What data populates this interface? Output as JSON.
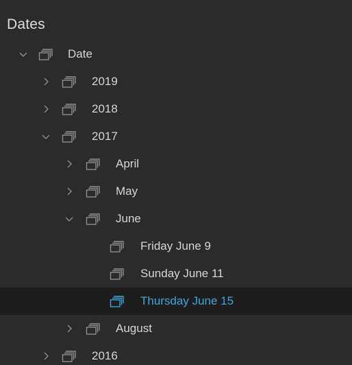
{
  "panel": {
    "title": "Dates"
  },
  "colors": {
    "background": "#2b2b2b",
    "selected_row": "#1d1d1d",
    "selected_text": "#3aa6dc",
    "text": "#d6d6d6",
    "icon": "#8e8e8e"
  },
  "tree": {
    "root": {
      "label": "Date",
      "expanded": true
    },
    "y2019": {
      "label": "2019",
      "expanded": false
    },
    "y2018": {
      "label": "2018",
      "expanded": false
    },
    "y2017": {
      "label": "2017",
      "expanded": true
    },
    "april": {
      "label": "April",
      "expanded": false
    },
    "may": {
      "label": "May",
      "expanded": false
    },
    "june": {
      "label": "June",
      "expanded": true
    },
    "friday_june_9": {
      "label": "Friday June 9"
    },
    "sunday_june_11": {
      "label": "Sunday June 11"
    },
    "thursday_june_15": {
      "label": "Thursday June 15",
      "selected": true
    },
    "august": {
      "label": "August",
      "expanded": false
    },
    "y2016": {
      "label": "2016",
      "expanded": false
    }
  },
  "icons": {
    "expand": "chevron-down-icon",
    "collapse": "chevron-right-icon",
    "folder": "stacked-folder-icon"
  }
}
